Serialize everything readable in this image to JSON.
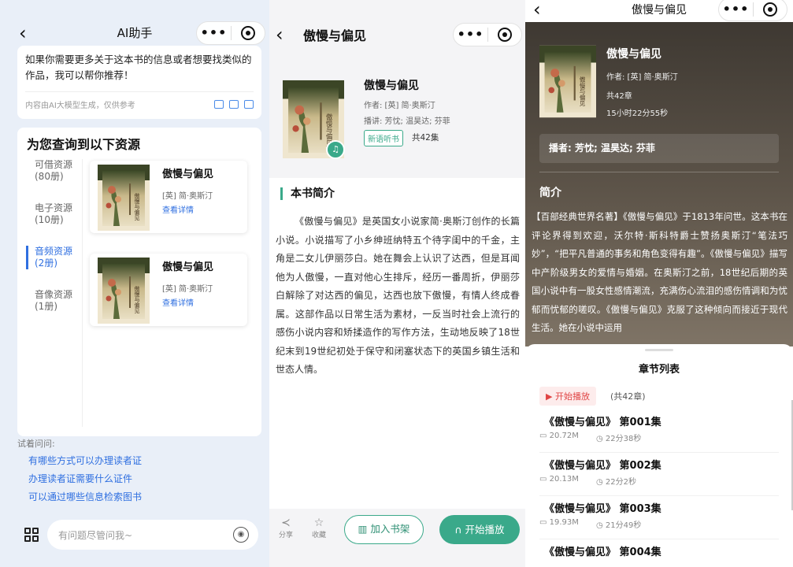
{
  "p1": {
    "title": "AI助手",
    "ai_message": "如果你需要更多关于这本书的信息或者想要找类似的作品，我可以帮你推荐！",
    "ai_note": "内容由AI大模型生成，仅供参考",
    "results_heading": "为您查询到以下资源",
    "categories": [
      {
        "name": "可借资源",
        "count": "(80册)"
      },
      {
        "name": "电子资源",
        "count": "(10册)"
      },
      {
        "name": "音频资源",
        "count": "(2册)"
      },
      {
        "name": "音像资源",
        "count": "(1册)"
      }
    ],
    "books": [
      {
        "title": "傲慢与偏见",
        "author": "[英] 简·奥斯汀",
        "link": "查看详情"
      },
      {
        "title": "傲慢与偏见",
        "author": "[英] 简·奥斯汀",
        "link": "查看详情"
      }
    ],
    "try_label": "试着问问:",
    "suggestions": [
      "有哪些方式可以办理读者证",
      "办理读者证需要什么证件",
      "可以通过哪些信息检索图书"
    ],
    "input_placeholder": "有问题尽管问我~"
  },
  "p2": {
    "title": "傲慢与偏见",
    "book_title": "傲慢与偏见",
    "author": "作者: [英] 简·奥斯汀",
    "narrators": "播讲: 芳忱; 温昊达; 芬菲",
    "tag": "新语听书",
    "episodes": "共42集",
    "section_title": "本书简介",
    "summary": "《傲慢与偏见》是英国女小说家简·奥斯汀创作的长篇小说。小说描写了小乡绅班纳特五个待字闺中的千金，主角是二女儿伊丽莎白。她在舞会上认识了达西，但是耳闻他为人傲慢，一直对他心生排斥，经历一番周折，伊丽莎白解除了对达西的偏见，达西也放下傲慢，有情人终成眷属。这部作品以日常生活为素材，一反当时社会上流行的感伤小说内容和矫揉造作的写作方法，生动地反映了18世纪末到19世纪初处于保守和闭塞状态下的英国乡镇生活和世态人情。",
    "share": "分享",
    "favorite": "收藏",
    "add_shelf": "加入书架",
    "start_play": "开始播放"
  },
  "p3": {
    "title": "傲慢与偏见",
    "book_title": "傲慢与偏见",
    "author": "作者: [英] 简·奥斯汀",
    "chapters_count": "共42章",
    "duration": "15小时22分55秒",
    "narrators": "播者: 芳忱; 温昊达; 芬菲",
    "intro_heading": "简介",
    "intro": "【百部经典世界名著】《傲慢与偏见》于1813年问世。这本书在评论界得到欢迎，沃尔特·斯科特爵士赞扬奥斯汀“笔法巧妙”，“把平凡普通的事务和角色变得有趣”。《傲慢与偏见》描写中产阶级男女的爱情与婚姻。在奥斯汀之前，18世纪后期的英国小说中有一股女性感情潮流，充满伤心流泪的感伤情调和为忧郁而忧郁的嗟叹。《傲慢与偏见》克服了这种倾向而接近于现代生活。她在小说中运用",
    "sheet_title": "章节列表",
    "start_play": "开始播放",
    "total": "(共42章)",
    "chapters": [
      {
        "title": "《傲慢与偏见》 第001集",
        "size": "20.72M",
        "duration": "22分38秒"
      },
      {
        "title": "《傲慢与偏见》 第002集",
        "size": "20.13M",
        "duration": "22分2秒"
      },
      {
        "title": "《傲慢与偏见》 第003集",
        "size": "19.93M",
        "duration": "21分49秒"
      },
      {
        "title": "《傲慢与偏见》 第004集",
        "size": "",
        "duration": ""
      }
    ]
  },
  "colors": {
    "accent_blue": "#2f6fe0",
    "accent_green": "#3aa98a",
    "play_red": "#e04545"
  },
  "icons": [
    "chevron-left-icon",
    "more-dots-icon",
    "target-icon",
    "copy-icon",
    "share-icon",
    "feedback-icon",
    "grid-icon",
    "voice-icon",
    "headphone-icon",
    "share-icon",
    "star-icon",
    "bookshelf-icon",
    "play-icon",
    "folder-icon",
    "clock-icon"
  ]
}
